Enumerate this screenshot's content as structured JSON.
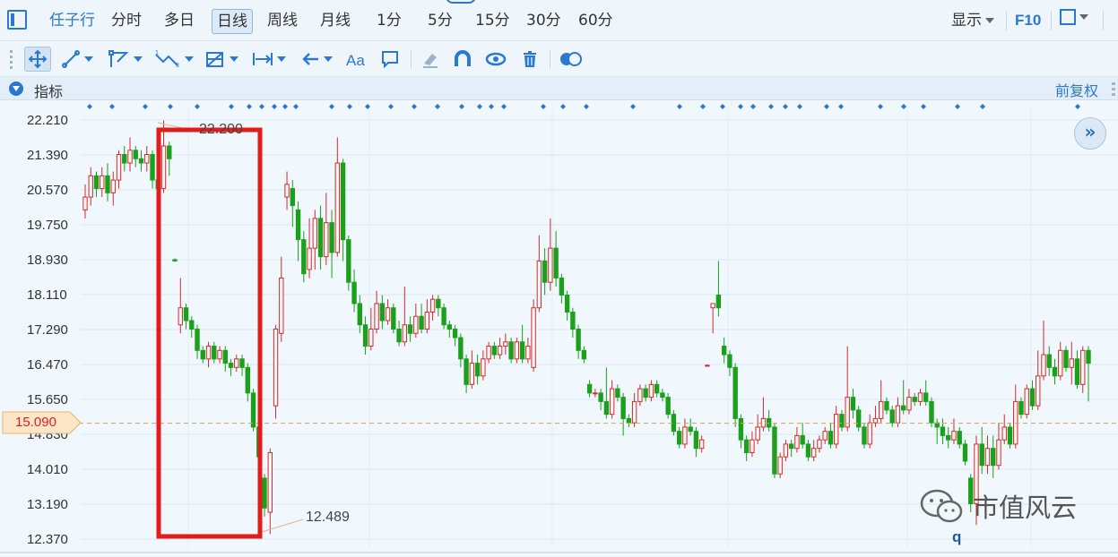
{
  "toolbar": {
    "timeframes": [
      "任子行",
      "分时",
      "多日",
      "日线",
      "周线",
      "月线",
      "1分",
      "5分",
      "15分",
      "30分",
      "60分"
    ],
    "active_timeframe": "日线",
    "display_label": "显示",
    "f10_label": "F10"
  },
  "indicator_bar": {
    "label": "指标",
    "adjust_label": "前复权"
  },
  "chart": {
    "y_ticks": [
      "22.210",
      "21.390",
      "20.570",
      "19.750",
      "18.930",
      "18.110",
      "17.290",
      "16.470",
      "15.650",
      "14.830",
      "14.010",
      "13.190",
      "12.370"
    ],
    "current_price": "15.090",
    "high_label": "22.200",
    "low_label": "12.489",
    "overlay_letter": "q",
    "colors": {
      "up": "#d42a2a",
      "down": "#1aa01a",
      "box": "#e21b1b",
      "accent": "#2a78d0"
    }
  },
  "watermark": {
    "text": "市值风云",
    "icon": "wechat-icon"
  },
  "chart_data": {
    "type": "candlestick",
    "ylim": [
      12.37,
      22.21
    ],
    "y_ticks": [
      22.21,
      21.39,
      20.57,
      19.75,
      18.93,
      18.11,
      17.29,
      16.47,
      15.65,
      14.83,
      14.01,
      13.19,
      12.37
    ],
    "reference_price": 15.09,
    "high": 22.2,
    "low": 12.489,
    "candles": [
      [
        20.1,
        20.4,
        19.9,
        20.7
      ],
      [
        20.4,
        20.9,
        20.2,
        21.1
      ],
      [
        20.9,
        20.6,
        20.4,
        21.0
      ],
      [
        20.6,
        20.9,
        20.4,
        21.1
      ],
      [
        20.9,
        20.5,
        20.3,
        21.2
      ],
      [
        20.5,
        20.8,
        20.2,
        21.0
      ],
      [
        20.8,
        21.4,
        20.6,
        21.5
      ],
      [
        21.4,
        21.2,
        21.0,
        21.6
      ],
      [
        21.2,
        21.5,
        21.0,
        21.8
      ],
      [
        21.5,
        21.3,
        21.1,
        21.6
      ],
      [
        21.3,
        21.2,
        21.0,
        21.5
      ],
      [
        21.2,
        21.4,
        21.0,
        21.6
      ],
      [
        21.4,
        20.8,
        20.6,
        21.5
      ],
      [
        20.8,
        20.6,
        20.4,
        21.0
      ],
      [
        20.6,
        21.6,
        20.5,
        22.2
      ],
      [
        21.6,
        21.3,
        20.9,
        21.7
      ],
      [
        18.93,
        18.9,
        18.88,
        18.96
      ],
      [
        17.4,
        17.8,
        17.2,
        18.5
      ],
      [
        17.8,
        17.5,
        17.3,
        17.9
      ],
      [
        17.5,
        17.3,
        17.1,
        17.6
      ],
      [
        17.3,
        16.8,
        16.6,
        17.4
      ],
      [
        16.8,
        16.6,
        16.5,
        16.9
      ],
      [
        16.6,
        16.9,
        16.4,
        17.0
      ],
      [
        16.9,
        16.6,
        16.5,
        17.0
      ],
      [
        16.6,
        16.8,
        16.5,
        16.9
      ],
      [
        16.8,
        16.5,
        16.3,
        16.9
      ],
      [
        16.5,
        16.4,
        16.2,
        16.6
      ],
      [
        16.4,
        16.6,
        16.3,
        16.7
      ],
      [
        16.6,
        16.4,
        16.2,
        16.7
      ],
      [
        16.4,
        15.8,
        15.6,
        16.5
      ],
      [
        15.8,
        15.0,
        14.9,
        15.9
      ],
      [
        15.0,
        14.3,
        14.2,
        15.2
      ],
      [
        13.8,
        13.1,
        12.9,
        13.9
      ],
      [
        13.0,
        14.4,
        12.489,
        14.5
      ],
      [
        15.5,
        17.3,
        15.2,
        17.4
      ],
      [
        17.2,
        18.5,
        17.0,
        19.0
      ],
      [
        20.4,
        20.7,
        20.1,
        21.0
      ],
      [
        20.6,
        20.2,
        19.7,
        20.8
      ],
      [
        20.1,
        19.4,
        18.9,
        20.3
      ],
      [
        19.4,
        18.6,
        18.4,
        19.6
      ],
      [
        18.7,
        19.2,
        18.5,
        19.9
      ],
      [
        19.2,
        19.9,
        18.7,
        20.1
      ],
      [
        19.9,
        19.0,
        18.7,
        20.2
      ],
      [
        19.0,
        19.8,
        18.8,
        20.5
      ],
      [
        19.8,
        19.1,
        18.5,
        20.1
      ],
      [
        19.1,
        21.2,
        19.0,
        21.8
      ],
      [
        21.2,
        19.4,
        18.9,
        21.3
      ],
      [
        19.4,
        18.4,
        18.2,
        19.5
      ],
      [
        18.4,
        17.9,
        17.7,
        18.7
      ],
      [
        17.9,
        17.4,
        17.2,
        18.1
      ],
      [
        17.4,
        16.9,
        16.7,
        17.6
      ],
      [
        16.9,
        17.3,
        16.8,
        17.8
      ],
      [
        17.3,
        17.9,
        17.2,
        18.2
      ],
      [
        17.9,
        17.5,
        17.3,
        18.1
      ],
      [
        17.5,
        17.8,
        17.4,
        18.0
      ],
      [
        17.8,
        17.3,
        17.2,
        17.9
      ],
      [
        17.3,
        17.0,
        16.9,
        17.5
      ],
      [
        17.0,
        17.4,
        16.9,
        18.3
      ],
      [
        17.4,
        17.2,
        17.0,
        17.6
      ],
      [
        17.2,
        17.6,
        17.1,
        17.9
      ],
      [
        17.6,
        17.3,
        17.2,
        17.9
      ],
      [
        17.3,
        17.7,
        17.2,
        18.0
      ],
      [
        17.7,
        18.0,
        17.5,
        18.1
      ],
      [
        18.0,
        17.8,
        17.6,
        18.1
      ],
      [
        17.8,
        17.4,
        17.3,
        17.9
      ],
      [
        17.4,
        17.3,
        17.1,
        17.5
      ],
      [
        17.3,
        17.1,
        16.9,
        17.4
      ],
      [
        17.1,
        16.6,
        16.4,
        17.2
      ],
      [
        16.6,
        16.0,
        15.8,
        16.7
      ],
      [
        16.0,
        16.5,
        15.9,
        16.8
      ],
      [
        16.5,
        16.2,
        16.0,
        16.7
      ],
      [
        16.2,
        16.6,
        16.1,
        16.8
      ],
      [
        16.6,
        16.9,
        16.5,
        17.0
      ],
      [
        16.9,
        16.7,
        16.6,
        17.0
      ],
      [
        16.7,
        16.9,
        16.6,
        17.1
      ],
      [
        16.9,
        17.0,
        16.7,
        17.2
      ],
      [
        17.0,
        16.6,
        16.5,
        17.1
      ],
      [
        16.6,
        17.0,
        16.5,
        17.1
      ],
      [
        17.0,
        16.6,
        16.5,
        17.4
      ],
      [
        16.6,
        16.9,
        16.5,
        17.1
      ],
      [
        16.4,
        17.8,
        16.3,
        18.0
      ],
      [
        17.8,
        18.9,
        17.7,
        19.5
      ],
      [
        18.9,
        18.4,
        18.1,
        19.2
      ],
      [
        18.4,
        19.2,
        18.2,
        19.9
      ],
      [
        19.2,
        18.5,
        18.3,
        19.6
      ],
      [
        18.5,
        18.1,
        17.9,
        18.6
      ],
      [
        18.1,
        17.7,
        17.5,
        18.2
      ],
      [
        17.7,
        17.3,
        17.1,
        17.8
      ],
      [
        17.3,
        16.8,
        16.6,
        17.4
      ],
      [
        16.8,
        16.6,
        16.5,
        16.9
      ],
      [
        16.0,
        15.8,
        15.7,
        16.1
      ],
      [
        15.8,
        15.8,
        15.7,
        15.9
      ],
      [
        15.8,
        15.6,
        15.4,
        15.9
      ],
      [
        15.6,
        15.3,
        15.2,
        16.4
      ],
      [
        15.3,
        15.9,
        15.2,
        16.1
      ],
      [
        15.9,
        15.7,
        15.6,
        16.0
      ],
      [
        15.7,
        15.2,
        14.8,
        15.8
      ],
      [
        15.2,
        15.1,
        15.0,
        15.3
      ],
      [
        15.1,
        15.6,
        15.0,
        15.8
      ],
      [
        15.6,
        15.9,
        15.5,
        16.0
      ],
      [
        15.9,
        15.7,
        15.6,
        16.0
      ],
      [
        15.7,
        16.0,
        15.6,
        16.1
      ],
      [
        16.0,
        15.8,
        15.7,
        16.1
      ],
      [
        15.8,
        15.7,
        15.6,
        15.9
      ],
      [
        15.7,
        15.3,
        15.2,
        15.8
      ],
      [
        15.3,
        14.9,
        14.8,
        15.4
      ],
      [
        14.9,
        14.6,
        14.5,
        15.0
      ],
      [
        14.6,
        15.0,
        14.5,
        15.2
      ],
      [
        15.0,
        14.9,
        14.8,
        15.2
      ],
      [
        14.9,
        14.5,
        14.3,
        15.0
      ],
      [
        14.5,
        14.7,
        14.4,
        14.8
      ],
      [
        16.45,
        16.45,
        16.43,
        16.47
      ],
      [
        17.8,
        17.9,
        17.2,
        17.9
      ],
      [
        18.1,
        17.8,
        17.6,
        18.9
      ],
      [
        16.9,
        16.7,
        16.5,
        17.1
      ],
      [
        16.7,
        16.4,
        16.2,
        16.8
      ],
      [
        16.4,
        15.2,
        15.0,
        16.5
      ],
      [
        15.2,
        14.7,
        14.5,
        15.3
      ],
      [
        14.7,
        14.4,
        14.2,
        14.8
      ],
      [
        14.4,
        14.7,
        14.3,
        14.9
      ],
      [
        14.7,
        15.0,
        14.6,
        15.3
      ],
      [
        15.0,
        15.2,
        14.9,
        15.7
      ],
      [
        15.2,
        15.0,
        14.9,
        15.4
      ],
      [
        15.0,
        13.9,
        13.8,
        15.1
      ],
      [
        13.9,
        14.3,
        13.8,
        14.4
      ],
      [
        14.3,
        14.6,
        14.2,
        14.7
      ],
      [
        14.6,
        14.5,
        14.3,
        14.7
      ],
      [
        14.5,
        14.8,
        14.4,
        15.0
      ],
      [
        14.8,
        14.6,
        14.5,
        15.1
      ],
      [
        14.6,
        14.3,
        14.2,
        14.7
      ],
      [
        14.3,
        14.5,
        14.2,
        14.7
      ],
      [
        14.5,
        14.7,
        14.4,
        14.8
      ],
      [
        14.7,
        14.9,
        14.6,
        15.0
      ],
      [
        14.9,
        14.6,
        14.5,
        15.1
      ],
      [
        14.6,
        15.3,
        14.5,
        15.5
      ],
      [
        15.3,
        15.0,
        14.9,
        15.4
      ],
      [
        15.0,
        15.7,
        14.9,
        16.9
      ],
      [
        15.7,
        15.4,
        15.2,
        15.9
      ],
      [
        15.4,
        15.0,
        14.9,
        15.5
      ],
      [
        15.0,
        14.6,
        14.5,
        15.1
      ],
      [
        14.6,
        15.1,
        14.5,
        15.3
      ],
      [
        15.1,
        15.2,
        15.0,
        15.5
      ],
      [
        15.2,
        15.6,
        15.1,
        16.1
      ],
      [
        15.6,
        15.4,
        15.3,
        15.7
      ],
      [
        15.4,
        15.1,
        15.0,
        15.5
      ],
      [
        15.1,
        15.5,
        15.0,
        15.7
      ],
      [
        15.5,
        15.4,
        15.3,
        16.1
      ],
      [
        15.4,
        15.7,
        15.3,
        15.9
      ],
      [
        15.7,
        15.6,
        15.5,
        15.8
      ],
      [
        15.6,
        15.8,
        15.5,
        15.9
      ],
      [
        15.8,
        15.6,
        15.5,
        16.1
      ],
      [
        15.6,
        15.1,
        15.0,
        15.7
      ],
      [
        15.1,
        15.0,
        14.6,
        15.2
      ],
      [
        15.0,
        14.8,
        14.6,
        15.2
      ],
      [
        14.8,
        14.7,
        14.5,
        15.0
      ],
      [
        14.7,
        14.9,
        14.6,
        15.2
      ],
      [
        14.9,
        14.6,
        14.5,
        15.0
      ],
      [
        14.6,
        14.2,
        14.1,
        14.7
      ],
      [
        13.8,
        13.2,
        13.0,
        13.9
      ],
      [
        13.2,
        14.6,
        12.7,
        14.8
      ],
      [
        14.6,
        14.1,
        13.9,
        15.0
      ],
      [
        14.1,
        14.5,
        13.9,
        14.8
      ],
      [
        14.5,
        14.1,
        13.8,
        14.8
      ],
      [
        14.1,
        14.7,
        14.0,
        15.1
      ],
      [
        14.7,
        15.0,
        14.6,
        15.3
      ],
      [
        15.0,
        14.6,
        14.5,
        15.1
      ],
      [
        14.6,
        15.6,
        14.5,
        16.0
      ],
      [
        15.6,
        15.3,
        15.2,
        15.7
      ],
      [
        15.3,
        15.9,
        15.2,
        16.0
      ],
      [
        15.9,
        15.5,
        15.4,
        16.1
      ],
      [
        15.5,
        16.2,
        15.4,
        16.8
      ],
      [
        16.2,
        16.7,
        16.1,
        17.5
      ],
      [
        16.7,
        16.4,
        16.2,
        16.9
      ],
      [
        16.4,
        16.2,
        16.0,
        16.6
      ],
      [
        16.2,
        16.8,
        16.1,
        17.0
      ],
      [
        16.8,
        16.4,
        16.3,
        16.9
      ],
      [
        16.4,
        16.6,
        16.0,
        17.0
      ],
      [
        16.6,
        16.0,
        15.9,
        16.8
      ],
      [
        16.0,
        16.8,
        15.8,
        16.9
      ],
      [
        16.8,
        16.5,
        15.6,
        16.9
      ]
    ]
  }
}
